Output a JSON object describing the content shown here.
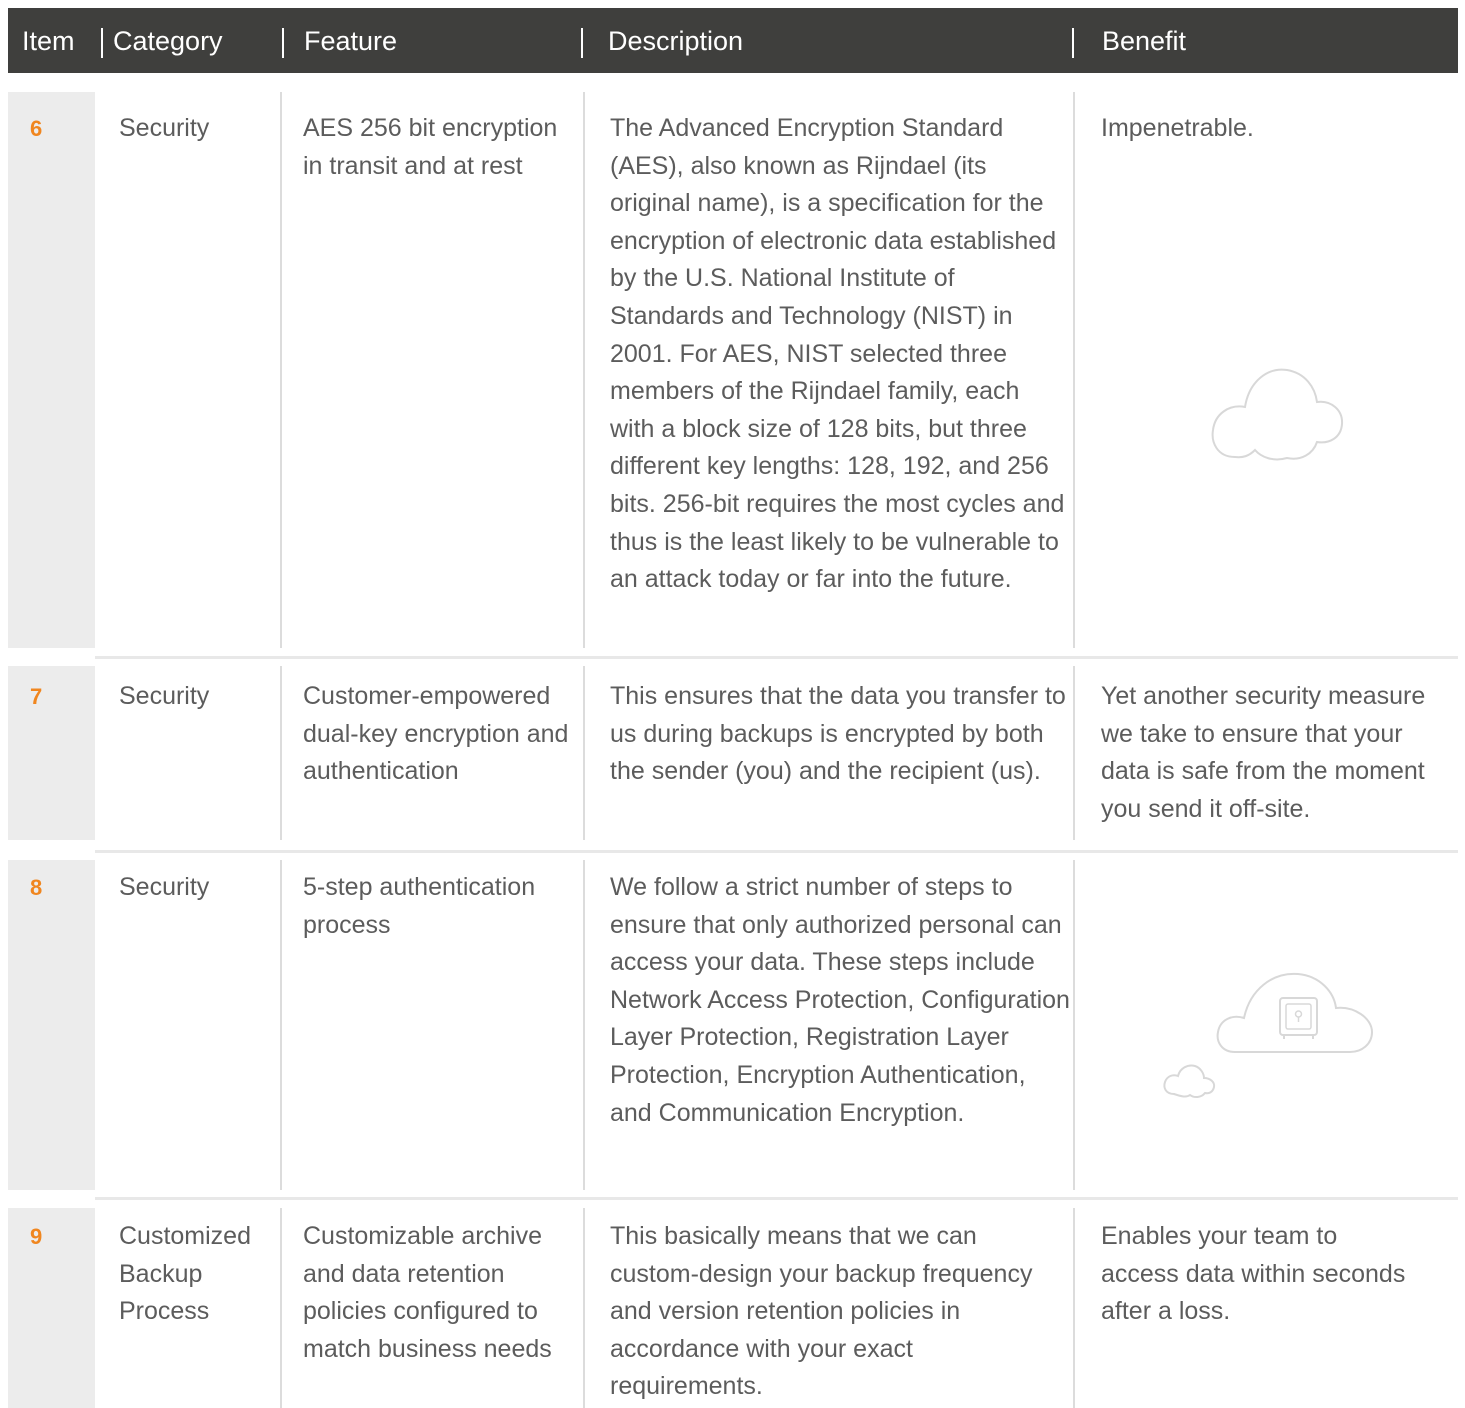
{
  "header": {
    "columns": [
      "Item",
      "Category",
      "Feature",
      "Description",
      "Benefit"
    ]
  },
  "rows": [
    {
      "item": "6",
      "category": "Security",
      "feature": "AES 256 bit encryption in transit and at rest",
      "description": "The Advanced Encryption Standard (AES), also known as Rijndael (its original name), is a specification for the encryption of electronic data established by the U.S. National Institute of Standards and Technology (NIST) in 2001. For AES, NIST selected three members of the Rijndael family, each with a block size of 128 bits, but three different key lengths: 128, 192, and 256 bits. 256-bit requires the most cycles and thus is the least likely to be vulnerable to an attack today or far into the future.",
      "benefit": "Impenetrable.",
      "illustration": "cloud-icon"
    },
    {
      "item": "7",
      "category": "Security",
      "feature": "Customer-empowered dual-key encryption and authentication",
      "description": "This ensures that the data you transfer to us during backups is encrypted by both the sender (you) and the recipient (us).",
      "benefit": "Yet another security measure we take to ensure that your data is safe from the moment you send it off-site."
    },
    {
      "item": "8",
      "category": "Security",
      "feature": "5-step authentication process",
      "description": "We follow a strict number of steps to ensure that only authorized personal can access your data. These steps include Network Access Protection, Configuration Layer Protection, Registration Layer Protection, Encryption Authentication, and Communication Encryption.",
      "benefit": "",
      "illustration": "cloud-safe-icon"
    },
    {
      "item": "9",
      "category": "Customized Backup Process",
      "feature": "Customizable archive and data retention policies configured to match business needs",
      "description": "This basically means that we can custom-design your backup frequency and version retention policies in accordance with your exact requirements.",
      "benefit": "Enables your team to access data within seconds after a loss."
    }
  ],
  "colors": {
    "header_bg": "#3f3f3d",
    "item_number": "#f0861f",
    "item_cell_bg": "#ececec",
    "text": "#5c5c5c"
  }
}
